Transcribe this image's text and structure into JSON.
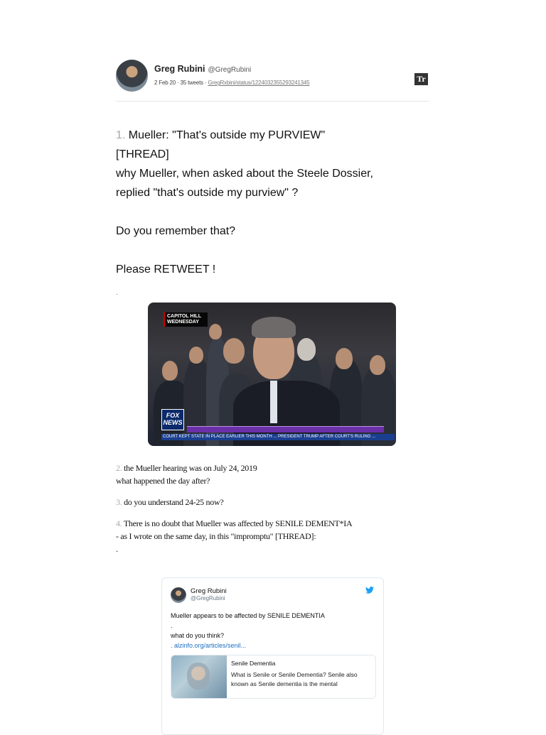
{
  "author": {
    "name": "Greg Rubini",
    "handle": "@GregRubini",
    "meta": "2 Feb 20 · 35 tweets · ",
    "meta_link": "GregRxbini/status/1224032355293241345",
    "badge": "Tr"
  },
  "tweet1": {
    "number": "1.",
    "lines": [
      " Mueller: \"That's outside my PURVIEW\"",
      "[THREAD]",
      "why Mueller, when asked about the Steele Dossier,",
      "replied \"that's outside my purview\" ?",
      "Do you remember that?",
      "Please RETWEET !",
      "."
    ]
  },
  "video": {
    "label_line1": "CAPITOL HILL",
    "label_line2": "WEDNESDAY",
    "logo_line1": "FOX",
    "logo_line2": "NEWS",
    "ticker": "COURT KEPT STATE IN PLACE EARLIER THIS MONTH ... PRESIDENT TRUMP AFTER COURT'S RULING ..."
  },
  "tweets": [
    {
      "number": "2.",
      "lines": [
        " the Mueller hearing was on July 24, 2019",
        "what happened the day after?"
      ]
    },
    {
      "number": "3.",
      "lines": [
        " do you understand 24-25 now?"
      ]
    },
    {
      "number": "4.",
      "lines": [
        " There is no doubt that Mueller was affected by SENILE DEMENT*IA",
        "- as I wrote on the same day, in this \"impromptu\" [THREAD]:",
        "."
      ]
    }
  ],
  "embed": {
    "name": "Greg Rubini",
    "handle": "@GregRubini",
    "lines": [
      "Mueller appears to be affected by SENILE DEMENTIA",
      ".",
      "what do you think?"
    ],
    "link": ". alzinfo.org/articles/senil...",
    "preview_title": "Senile Dementia",
    "preview_desc": "What is Senile or Senile Dementia? Senile also known as Senile dementia is the mental"
  },
  "colors": {
    "number_gray": "#a9a9a9",
    "link_blue": "#1b6ec2",
    "twitter_blue": "#1da1f2"
  },
  "icons": [
    "twitter-bird-icon"
  ]
}
